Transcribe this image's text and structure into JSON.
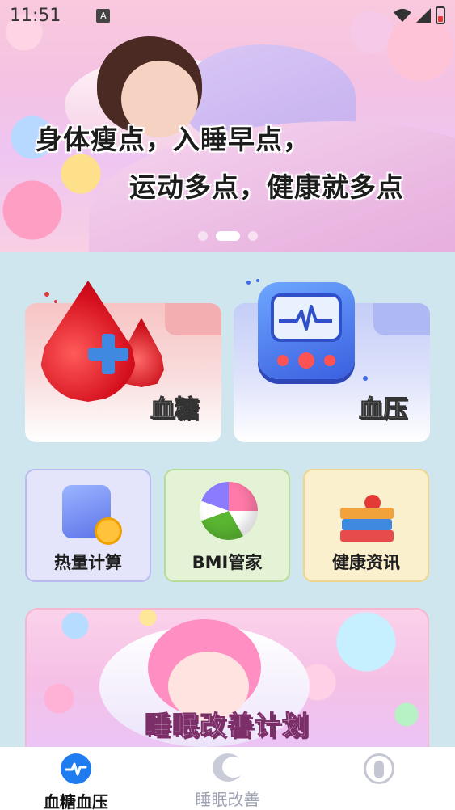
{
  "status_bar": {
    "time": "11:51",
    "notification_icon": "a-icon"
  },
  "banner": {
    "line1": "身体瘦点，入睡早点，",
    "line2": "运动多点，健康就多点",
    "slides": 3,
    "active_slide": 1
  },
  "features": {
    "blood_sugar": {
      "label": "血糖",
      "icon": "blood-drop-plus-icon"
    },
    "blood_pressure": {
      "label": "血压",
      "icon": "pressure-monitor-icon"
    }
  },
  "tools": [
    {
      "label": "热量计算",
      "icon": "calculator-icon"
    },
    {
      "label": "BMI管家",
      "icon": "beach-ball-icon"
    },
    {
      "label": "健康资讯",
      "icon": "books-icon"
    }
  ],
  "sleep_plan": {
    "title": "睡眠改善计划"
  },
  "bottom_nav": {
    "items": [
      {
        "label": "血糖血压",
        "icon": "heartbeat-icon",
        "active": true
      },
      {
        "label": "睡眠改善",
        "icon": "moon-icon",
        "active": false
      },
      {
        "label": "",
        "icon": "user-icon",
        "active": false
      }
    ]
  },
  "colors": {
    "page_bg": "#cfe6ee",
    "accent": "#1e7bf0",
    "sugar_red": "#d40f1d",
    "pressure_blue": "#3a5fe0"
  }
}
